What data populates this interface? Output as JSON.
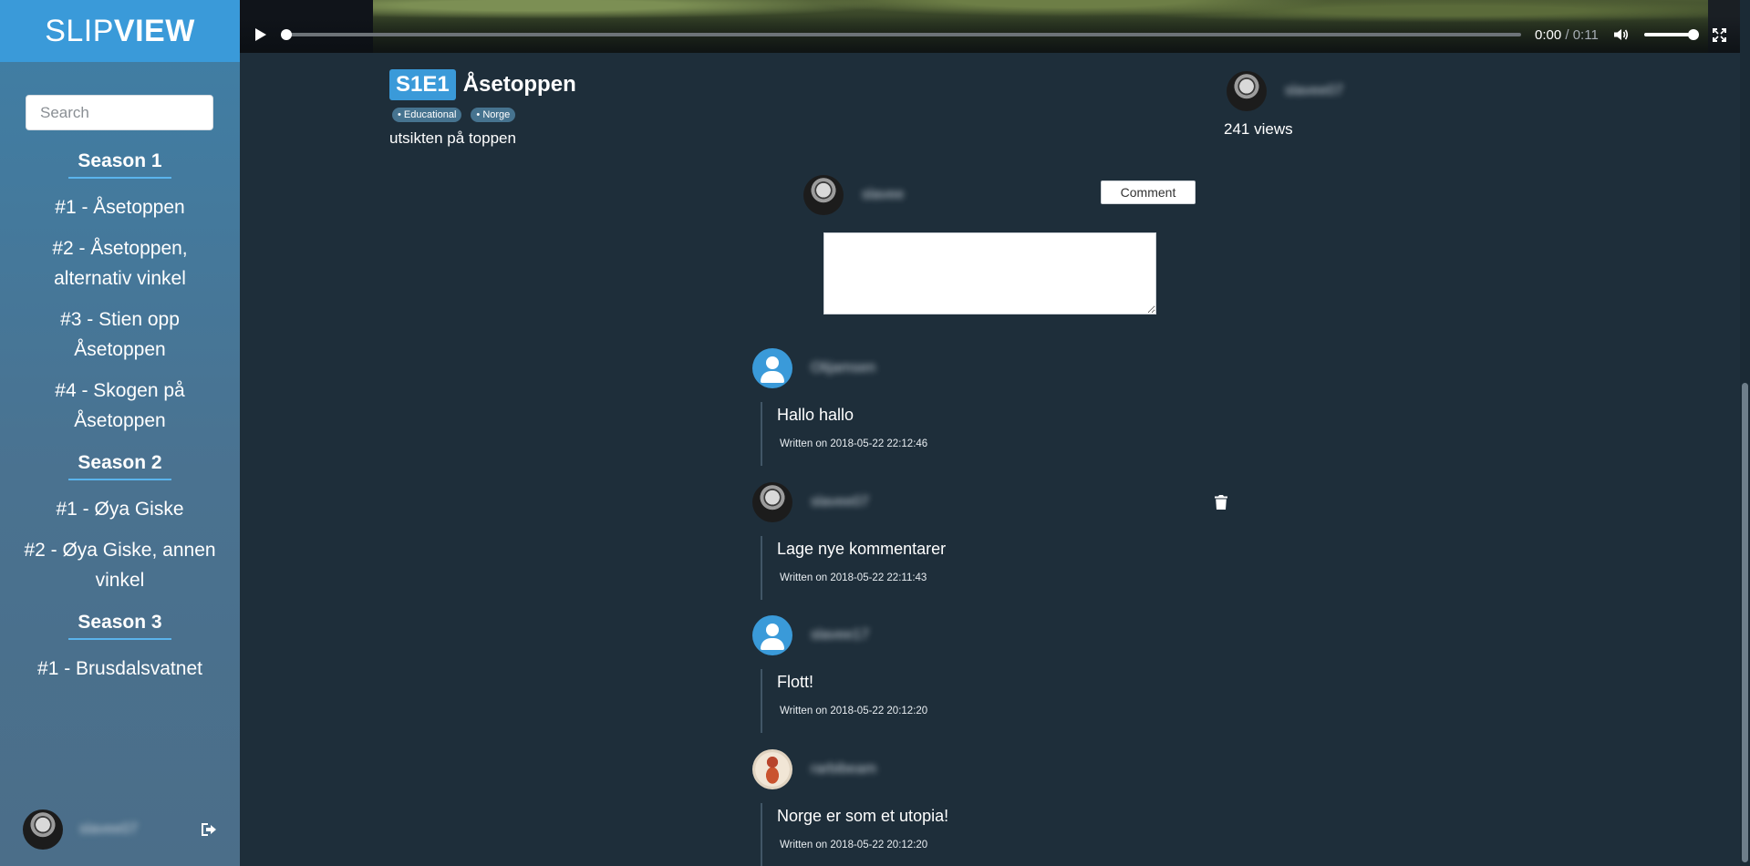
{
  "brand": {
    "light": "SLIP",
    "bold": "VIEW"
  },
  "search": {
    "placeholder": "Search"
  },
  "seasons": [
    {
      "title": "Season 1",
      "episodes": [
        "#1 - Åsetoppen",
        "#2 - Åsetoppen, alternativ vinkel",
        "#3 - Stien opp Åsetoppen",
        "#4 - Skogen på Åsetoppen"
      ]
    },
    {
      "title": "Season 2",
      "episodes": [
        "#1 - Øya Giske",
        "#2 - Øya Giske, annen vinkel"
      ]
    },
    {
      "title": "Season 3",
      "episodes": [
        "#1 - Brusdalsvatnet"
      ]
    }
  ],
  "sidebar_footer": {
    "username": "slavee07"
  },
  "player": {
    "current_time": "0:00",
    "separator": "/",
    "duration": "0:11",
    "progress": 0.0,
    "volume": 1.0
  },
  "episode": {
    "code": "S1E1",
    "title": "Åsetoppen",
    "tags": [
      "• Educational",
      "• Norge"
    ],
    "description": "utsikten på toppen"
  },
  "uploader": {
    "username": "slavee07",
    "views": "241 views"
  },
  "comment_form": {
    "username": "slavee",
    "button_label": "Comment"
  },
  "comments": [
    {
      "username": "Olijamsen",
      "avatar": "default-user-icon",
      "text": "Hallo hallo",
      "date": "Written on 2018-05-22 22:12:46",
      "deletable": false
    },
    {
      "username": "slavee07",
      "avatar": "photo",
      "text": "Lage nye kommentarer",
      "date": "Written on 2018-05-22 22:11:43",
      "deletable": true
    },
    {
      "username": "slavee17",
      "avatar": "default-user-icon",
      "text": "Flott!",
      "date": "Written on 2018-05-22 20:12:20",
      "deletable": false
    },
    {
      "username": "rarbibeam",
      "avatar": "art",
      "text": "Norge er som et utopia!",
      "date": "Written on 2018-05-22 20:12:20",
      "deletable": false
    }
  ],
  "colors": {
    "accent": "#3a9ad9",
    "background": "#1e2e3a",
    "tag": "#46738f"
  }
}
